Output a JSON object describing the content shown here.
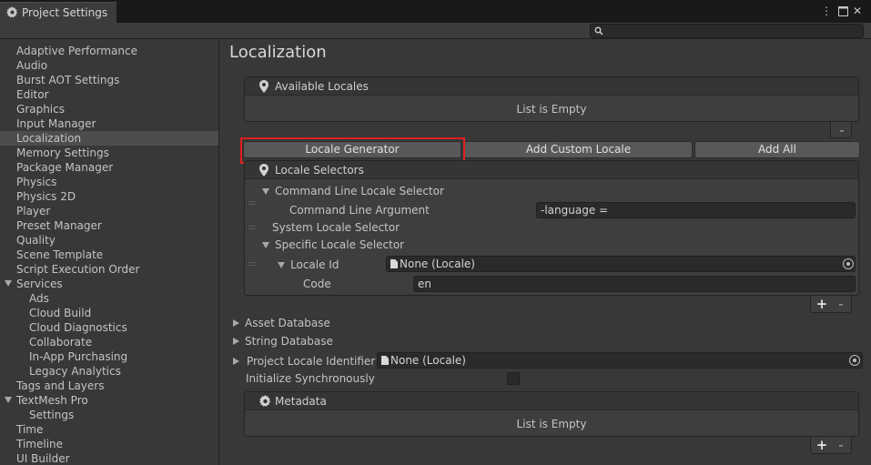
{
  "window": {
    "title": "Project Settings",
    "menu_icon": "kebab-menu-icon",
    "maximize_icon": "maximize-icon",
    "close_icon": "close-icon"
  },
  "search": {
    "placeholder": "",
    "icon": "search-icon"
  },
  "sidebar": {
    "items": [
      {
        "label": "Adaptive Performance"
      },
      {
        "label": "Audio"
      },
      {
        "label": "Burst AOT Settings"
      },
      {
        "label": "Editor"
      },
      {
        "label": "Graphics"
      },
      {
        "label": "Input Manager"
      },
      {
        "label": "Localization",
        "selected": true
      },
      {
        "label": "Memory Settings"
      },
      {
        "label": "Package Manager"
      },
      {
        "label": "Physics"
      },
      {
        "label": "Physics 2D"
      },
      {
        "label": "Player"
      },
      {
        "label": "Preset Manager"
      },
      {
        "label": "Quality"
      },
      {
        "label": "Scene Template"
      },
      {
        "label": "Script Execution Order"
      },
      {
        "label": "Services",
        "expanded": true
      },
      {
        "label": "Ads",
        "child": true
      },
      {
        "label": "Cloud Build",
        "child": true
      },
      {
        "label": "Cloud Diagnostics",
        "child": true
      },
      {
        "label": "Collaborate",
        "child": true
      },
      {
        "label": "In-App Purchasing",
        "child": true
      },
      {
        "label": "Legacy Analytics",
        "child": true
      },
      {
        "label": "Tags and Layers"
      },
      {
        "label": "TextMesh Pro",
        "expanded": true
      },
      {
        "label": "Settings",
        "child": true
      },
      {
        "label": "Time"
      },
      {
        "label": "Timeline"
      },
      {
        "label": "UI Builder"
      }
    ]
  },
  "main": {
    "title": "Localization",
    "available_locales": {
      "header": "Available Locales",
      "empty_text": "List is Empty",
      "remove_label": "-"
    },
    "buttons": {
      "locale_generator": "Locale Generator",
      "add_custom_locale": "Add Custom Locale",
      "add_all": "Add All"
    },
    "locale_selectors": {
      "header": "Locale Selectors",
      "command_line": "Command Line Locale Selector",
      "command_line_argument_label": "Command Line Argument",
      "command_line_argument_value": "-language =",
      "system": "System Locale Selector",
      "specific": "Specific Locale Selector",
      "locale_id_label": "Locale Id",
      "locale_id_value": "None (Locale)",
      "code_label": "Code",
      "code_value": "en",
      "add_label": "+",
      "remove_label": "-"
    },
    "asset_database": "Asset Database",
    "string_database": "String Database",
    "project_locale_identifier_label": "Project Locale Identifier",
    "project_locale_identifier_value": "None (Locale)",
    "initialize_synchronously_label": "Initialize Synchronously",
    "initialize_synchronously_checked": false,
    "metadata": {
      "header": "Metadata",
      "empty_text": "List is Empty",
      "add_label": "+",
      "remove_label": "-"
    }
  },
  "colors": {
    "highlight": "#e01f1f",
    "background": "#383838",
    "selected": "#4d4d4d"
  }
}
